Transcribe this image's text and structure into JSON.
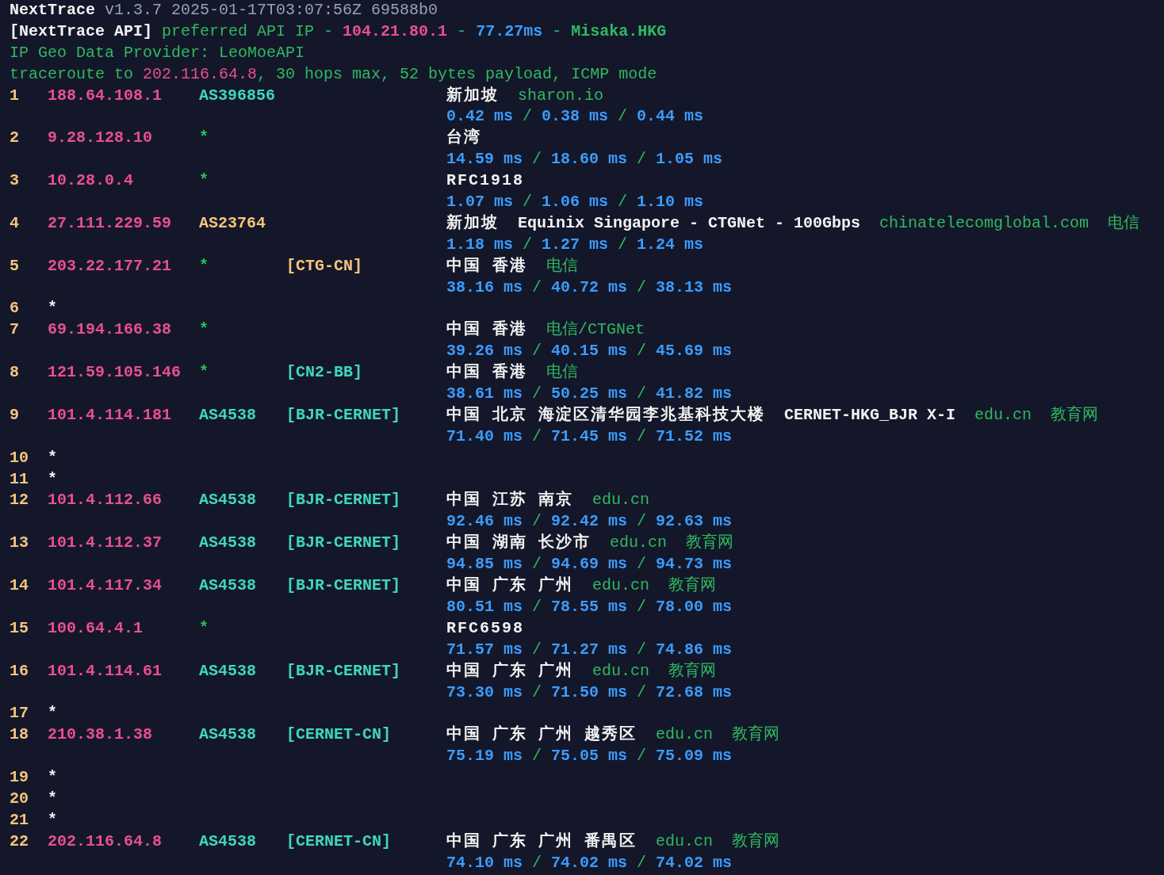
{
  "header": [
    [
      {
        "kind": "title",
        "text": "NextTrace"
      },
      {
        "kind": "muted",
        "text": " v1.3.7 2025-01-17T03:07:56Z 69588b0"
      }
    ],
    [
      {
        "kind": "title",
        "text": "[NextTrace API]"
      },
      {
        "kind": "text",
        "text": " preferred API IP - "
      },
      {
        "kind": "ip",
        "text": "104.21.80.1"
      },
      {
        "kind": "text",
        "text": " - "
      },
      {
        "kind": "latency",
        "text": "77.27ms"
      },
      {
        "kind": "text",
        "text": " - "
      },
      {
        "kind": "node",
        "text": "Misaka.HKG"
      }
    ],
    [
      {
        "kind": "text",
        "text": "IP Geo Data Provider: LeoMoeAPI"
      }
    ],
    [
      {
        "kind": "text",
        "text": "traceroute to "
      },
      {
        "kind": "target",
        "text": "202.116.64.8"
      },
      {
        "kind": "text",
        "text": ", 30 hops max, 52 bytes payload, ICMP mode"
      }
    ]
  ],
  "rtt_separator": "/",
  "hops": [
    {
      "kind": "reply",
      "hop": "1",
      "ip": "188.64.108.1",
      "asn": {
        "text": "AS396856",
        "color": "#3fd6c0"
      },
      "geo": "新加坡",
      "domain": "sharon.io",
      "rtt": [
        "0.42 ms",
        "0.38 ms",
        "0.44 ms"
      ]
    },
    {
      "kind": "reply",
      "hop": "2",
      "ip": "9.28.128.10",
      "asn": {
        "text": "*",
        "color": "#22c55e"
      },
      "geo": "台湾",
      "rtt": [
        "14.59 ms",
        "18.60 ms",
        "1.05 ms"
      ]
    },
    {
      "kind": "reply",
      "hop": "3",
      "ip": "10.28.0.4",
      "asn": {
        "text": "*",
        "color": "#22c55e"
      },
      "geo": "RFC1918",
      "rtt": [
        "1.07 ms",
        "1.06 ms",
        "1.10 ms"
      ]
    },
    {
      "kind": "reply",
      "hop": "4",
      "ip": "27.111.229.59",
      "asn": {
        "text": "AS23764",
        "color": "#f7c47d"
      },
      "geo": "新加坡",
      "router": "Equinix Singapore - CTGNet - 100Gbps",
      "domain": "chinatelecomglobal.com",
      "owner": "电信",
      "rtt": [
        "1.18 ms",
        "1.27 ms",
        "1.24 ms"
      ]
    },
    {
      "kind": "reply",
      "hop": "5",
      "ip": "203.22.177.21",
      "asn": {
        "text": "*",
        "color": "#22c55e"
      },
      "tag": {
        "text": "[CTG-CN]",
        "color": "#f7c47d"
      },
      "geo": "中国 香港",
      "owner": "电信",
      "rtt": [
        "38.16 ms",
        "40.72 ms",
        "38.13 ms"
      ]
    },
    {
      "kind": "timeout",
      "hop": "6",
      "ip": "*"
    },
    {
      "kind": "reply",
      "hop": "7",
      "ip": "69.194.166.38",
      "asn": {
        "text": "*",
        "color": "#22c55e"
      },
      "geo": "中国 香港",
      "owner": "电信/CTGNet",
      "rtt": [
        "39.26 ms",
        "40.15 ms",
        "45.69 ms"
      ]
    },
    {
      "kind": "reply",
      "hop": "8",
      "ip": "121.59.105.146",
      "asn": {
        "text": "*",
        "color": "#22c55e"
      },
      "tag": {
        "text": "[CN2-BB]",
        "color": "#3fd6c0"
      },
      "geo": "中国 香港",
      "owner": "电信",
      "rtt": [
        "38.61 ms",
        "50.25 ms",
        "41.82 ms"
      ]
    },
    {
      "kind": "reply",
      "hop": "9",
      "ip": "101.4.114.181",
      "asn": {
        "text": "AS4538",
        "color": "#3fd6c0"
      },
      "tag": {
        "text": "[BJR-CERNET]",
        "color": "#3fd6c0"
      },
      "geo": "中国 北京 海淀区清华园李兆基科技大楼",
      "router": "CERNET-HKG_BJR X-I",
      "domain": "edu.cn",
      "owner": "教育网",
      "rtt": [
        "71.40 ms",
        "71.45 ms",
        "71.52 ms"
      ]
    },
    {
      "kind": "timeout",
      "hop": "10",
      "ip": "*"
    },
    {
      "kind": "timeout",
      "hop": "11",
      "ip": "*"
    },
    {
      "kind": "reply",
      "hop": "12",
      "ip": "101.4.112.66",
      "asn": {
        "text": "AS4538",
        "color": "#3fd6c0"
      },
      "tag": {
        "text": "[BJR-CERNET]",
        "color": "#3fd6c0"
      },
      "geo": "中国 江苏 南京",
      "domain": "edu.cn",
      "rtt": [
        "92.46 ms",
        "92.42 ms",
        "92.63 ms"
      ]
    },
    {
      "kind": "reply",
      "hop": "13",
      "ip": "101.4.112.37",
      "asn": {
        "text": "AS4538",
        "color": "#3fd6c0"
      },
      "tag": {
        "text": "[BJR-CERNET]",
        "color": "#3fd6c0"
      },
      "geo": "中国 湖南 长沙市",
      "domain": "edu.cn",
      "owner": "教育网",
      "rtt": [
        "94.85 ms",
        "94.69 ms",
        "94.73 ms"
      ]
    },
    {
      "kind": "reply",
      "hop": "14",
      "ip": "101.4.117.34",
      "asn": {
        "text": "AS4538",
        "color": "#3fd6c0"
      },
      "tag": {
        "text": "[BJR-CERNET]",
        "color": "#3fd6c0"
      },
      "geo": "中国 广东 广州",
      "domain": "edu.cn",
      "owner": "教育网",
      "rtt": [
        "80.51 ms",
        "78.55 ms",
        "78.00 ms"
      ]
    },
    {
      "kind": "reply",
      "hop": "15",
      "ip": "100.64.4.1",
      "asn": {
        "text": "*",
        "color": "#22c55e"
      },
      "geo": "RFC6598",
      "rtt": [
        "71.57 ms",
        "71.27 ms",
        "74.86 ms"
      ]
    },
    {
      "kind": "reply",
      "hop": "16",
      "ip": "101.4.114.61",
      "asn": {
        "text": "AS4538",
        "color": "#3fd6c0"
      },
      "tag": {
        "text": "[BJR-CERNET]",
        "color": "#3fd6c0"
      },
      "geo": "中国 广东 广州",
      "domain": "edu.cn",
      "owner": "教育网",
      "rtt": [
        "73.30 ms",
        "71.50 ms",
        "72.68 ms"
      ]
    },
    {
      "kind": "timeout",
      "hop": "17",
      "ip": "*"
    },
    {
      "kind": "reply",
      "hop": "18",
      "ip": "210.38.1.38",
      "asn": {
        "text": "AS4538",
        "color": "#3fd6c0"
      },
      "tag": {
        "text": "[CERNET-CN]",
        "color": "#3fd6c0"
      },
      "geo": "中国 广东 广州 越秀区",
      "domain": "edu.cn",
      "owner": "教育网",
      "rtt": [
        "75.19 ms",
        "75.05 ms",
        "75.09 ms"
      ]
    },
    {
      "kind": "timeout",
      "hop": "19",
      "ip": "*"
    },
    {
      "kind": "timeout",
      "hop": "20",
      "ip": "*"
    },
    {
      "kind": "timeout",
      "hop": "21",
      "ip": "*"
    },
    {
      "kind": "reply",
      "hop": "22",
      "ip": "202.116.64.8",
      "asn": {
        "text": "AS4538",
        "color": "#3fd6c0"
      },
      "tag": {
        "text": "[CERNET-CN]",
        "color": "#3fd6c0"
      },
      "geo": "中国 广东 广州 番禺区",
      "domain": "edu.cn",
      "owner": "教育网",
      "rtt": [
        "74.10 ms",
        "74.02 ms",
        "74.02 ms"
      ]
    }
  ]
}
